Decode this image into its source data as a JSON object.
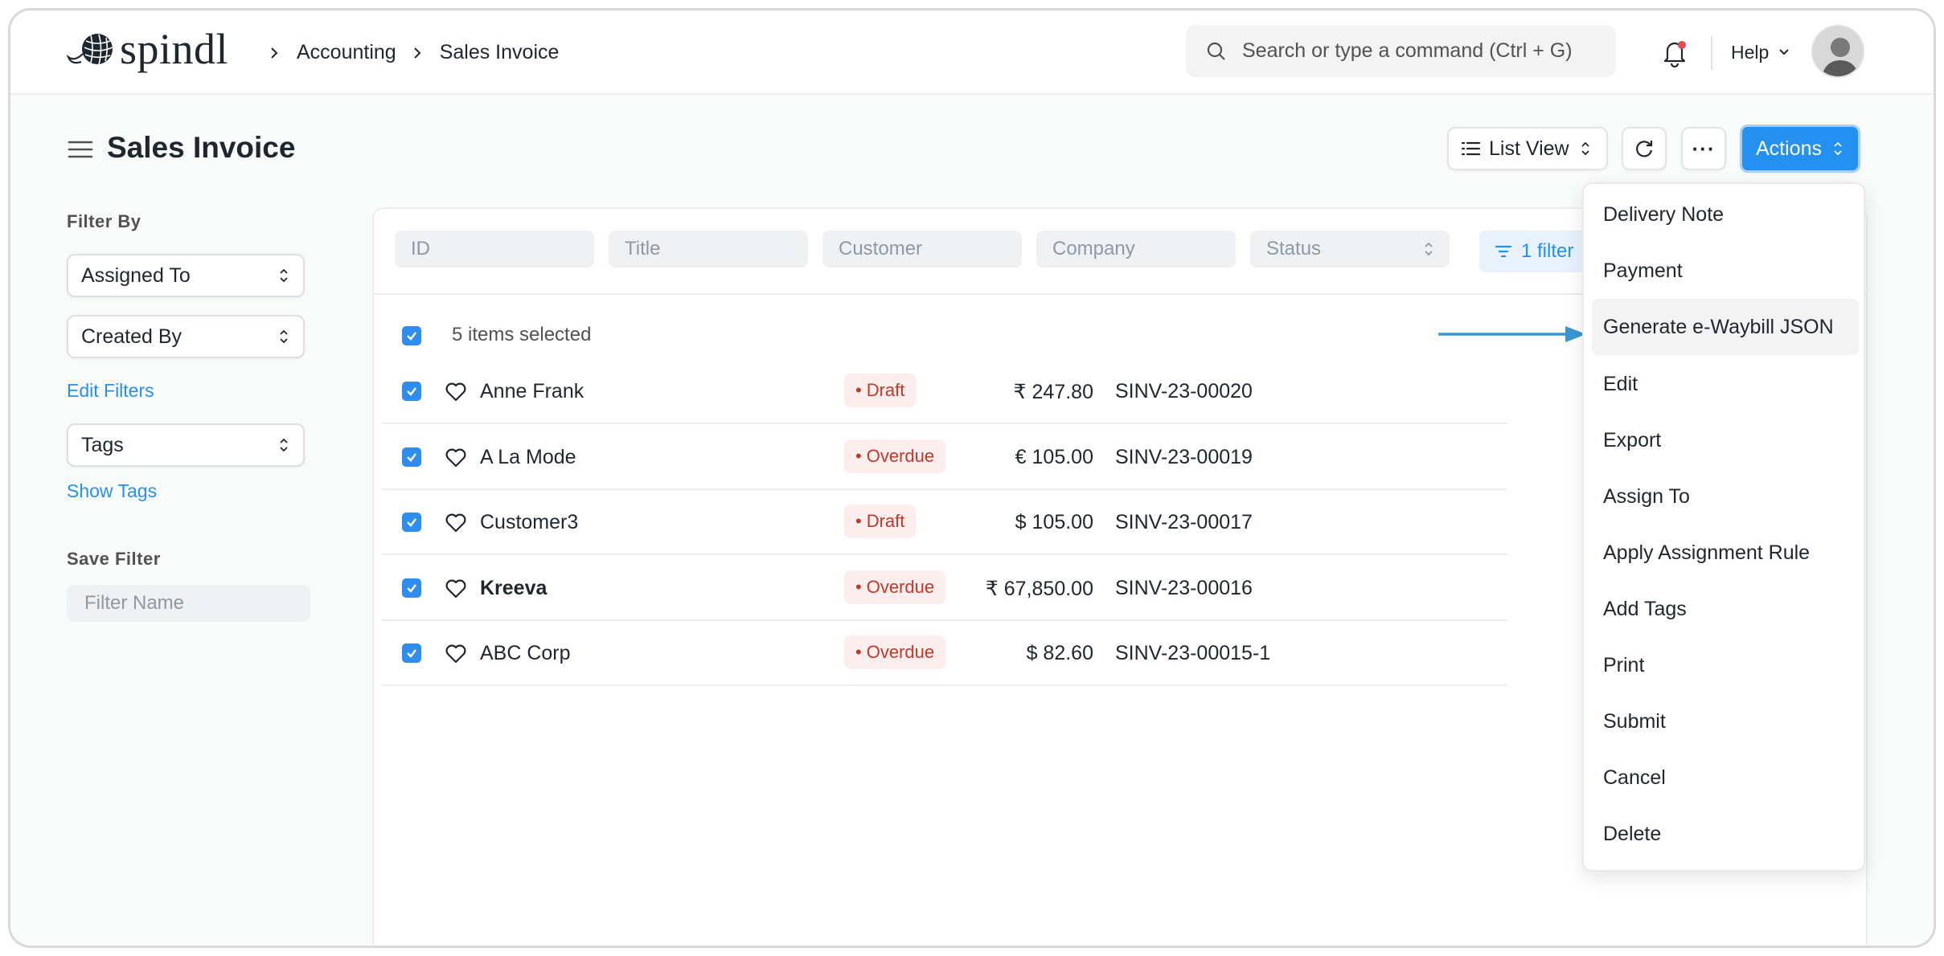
{
  "navbar": {
    "brand": "spindl",
    "breadcrumbs": [
      "Accounting",
      "Sales Invoice"
    ],
    "search_placeholder": "Search or type a command (Ctrl + G)",
    "help_label": "Help"
  },
  "page": {
    "title": "Sales Invoice",
    "list_view_label": "List View",
    "more_label": "···",
    "actions_label": "Actions"
  },
  "sidebar": {
    "filter_by_heading": "Filter By",
    "assigned_to": "Assigned To",
    "created_by": "Created By",
    "edit_filters": "Edit Filters",
    "tags": "Tags",
    "show_tags": "Show Tags",
    "save_filter_heading": "Save Filter",
    "filter_name_placeholder": "Filter Name"
  },
  "filters": {
    "id_placeholder": "ID",
    "title_placeholder": "Title",
    "customer_placeholder": "Customer",
    "company_placeholder": "Company",
    "status_placeholder": "Status",
    "filter_button": "1 filter"
  },
  "list": {
    "selected_text": "5 items selected",
    "rows": [
      {
        "name": "Anne Frank",
        "status": "Draft",
        "amount": "₹ 247.80",
        "id": "SINV-23-00020",
        "bold": false
      },
      {
        "name": "A La Mode",
        "status": "Overdue",
        "amount": "€ 105.00",
        "id": "SINV-23-00019",
        "bold": false
      },
      {
        "name": "Customer3",
        "status": "Draft",
        "amount": "$ 105.00",
        "id": "SINV-23-00017",
        "bold": false
      },
      {
        "name": "Kreeva",
        "status": "Overdue",
        "amount": "₹ 67,850.00",
        "id": "SINV-23-00016",
        "bold": true
      },
      {
        "name": "ABC Corp",
        "status": "Overdue",
        "amount": "$ 82.60",
        "id": "SINV-23-00015-1",
        "bold": false
      }
    ]
  },
  "actions_menu": {
    "items": [
      "Delivery Note",
      "Payment",
      "Generate e-Waybill JSON",
      "Edit",
      "Export",
      "Assign To",
      "Apply Assignment Rule",
      "Add Tags",
      "Print",
      "Submit",
      "Cancel",
      "Delete"
    ],
    "highlighted": "Generate e-Waybill JSON"
  },
  "colors": {
    "primary": "#2490ef",
    "badge_bg": "#fdeeee",
    "badge_text": "#c0392b",
    "arrow": "#3a97d4"
  }
}
